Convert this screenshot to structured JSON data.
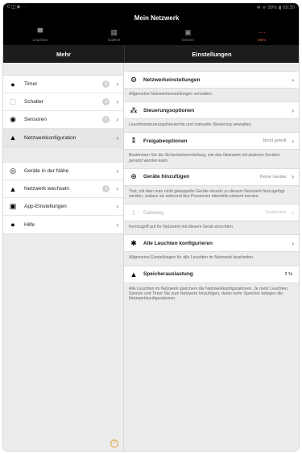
{
  "status_bar": {
    "left": "0 ◫ ▶ ···",
    "right": "✻ ᯤ 99% ▮ 08:30"
  },
  "window": {
    "title": "Mein Netzwerk"
  },
  "tabs": [
    {
      "label": "Leuchten",
      "icon": "lamp-icon",
      "active": false
    },
    {
      "label": "Gallerie",
      "icon": "gallery-icon",
      "active": false
    },
    {
      "label": "Szenen",
      "icon": "scenes-icon",
      "active": false
    },
    {
      "label": "Mehr",
      "icon": "more-icon",
      "active": true
    }
  ],
  "left_panel": {
    "header": "Mehr",
    "group1": [
      {
        "label": "Timer",
        "icon": "clock-icon",
        "badge": "0"
      },
      {
        "label": "Schalter",
        "icon": "switch-icon",
        "badge": "0"
      },
      {
        "label": "Sensoren",
        "icon": "sensor-icon",
        "badge": "0"
      },
      {
        "label": "Netzwerkkonfiguration",
        "icon": "network-icon",
        "badge": ""
      }
    ],
    "group2": [
      {
        "label": "Geräte in der Nähe",
        "icon": "nearby-icon",
        "badge": ""
      },
      {
        "label": "Netzwerk wechseln",
        "icon": "network-switch-icon",
        "badge": "0"
      },
      {
        "label": "App-Einstellungen",
        "icon": "app-settings-icon",
        "badge": ""
      },
      {
        "label": "Hilfe",
        "icon": "help-icon",
        "badge": ""
      }
    ]
  },
  "right_panel": {
    "header": "Einstellungen",
    "items": [
      {
        "label": "Netzwerkeinstellungen",
        "value": "",
        "description": "Allgemeine Netzwerkeinstellungen verwalten."
      },
      {
        "label": "Steuerungsoptionen",
        "value": "",
        "description": "Leuchtensteuerungshierarchie und manuelle Steuerung verwalten."
      },
      {
        "label": "Freigabeoptionen",
        "value": "Nicht geteilt",
        "description": "Bestimmen Sie die Sicherheitseinstellung, wie das Netzwerk mit anderen Geräten genutzt werden kann."
      },
      {
        "label": "Geräte hinzufügen",
        "value": "Keine Geräte",
        "description": "Tool, mit dem man nicht gekoppelte Geräte einzeln zu diesem Netzwerk hinzugefügt werden, sodass sie während des Prozesses ebenfalls erkannt werden."
      },
      {
        "label": "Gateway",
        "value": "Deaktiviert",
        "description": "Fernzugriff auf Ihr Netzwerk mit diesem Gerät einrichten."
      },
      {
        "label": "Alle Leuchten konfigurieren",
        "value": "",
        "description": "Allgemeine Einstellungen für alle Leuchten im Netzwerk bearbeiten."
      },
      {
        "label": "Speicherauslastung",
        "value": "2 %",
        "description": "Alle Leuchten im Netzwerk speichern die Netzwerkkonfigurationen. Je mehr Leuchten, Szenen und Timer Sie zum Netzwerk hinzufügen, desto mehr Speicher belegen die Netzwerkkonfigurationen."
      }
    ]
  },
  "colors": {
    "accent": "#e55b3a",
    "title_bg": "#000000",
    "panel_bg": "#ececec"
  }
}
